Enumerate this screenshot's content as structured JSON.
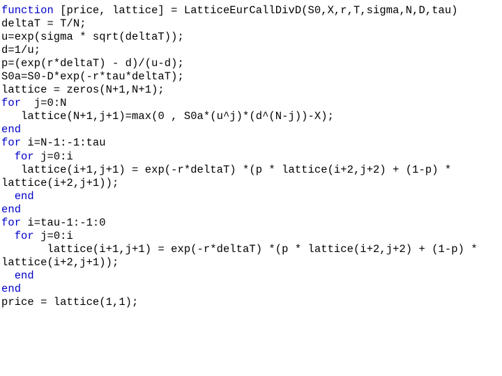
{
  "document": {
    "type": "matlab-code-listing",
    "background_color": "#ffffff",
    "text_color": "#000000",
    "keyword_color": "#0000c8",
    "font_family": "monospace",
    "line_count": 23
  },
  "code": {
    "language": "MATLAB",
    "function_name": "LatticeEurCallDivD",
    "lines": [
      {
        "indent": "",
        "keyword": "function",
        "rest": " [price, lattice] = LatticeEurCallDivD(S0,X,r,T,sigma,N,D,tau)"
      },
      {
        "indent": "",
        "keyword": "",
        "rest": "deltaT = T/N;"
      },
      {
        "indent": "",
        "keyword": "",
        "rest": "u=exp(sigma * sqrt(deltaT));"
      },
      {
        "indent": "",
        "keyword": "",
        "rest": "d=1/u;"
      },
      {
        "indent": "",
        "keyword": "",
        "rest": "p=(exp(r*deltaT) - d)/(u-d);"
      },
      {
        "indent": "",
        "keyword": "",
        "rest": "S0a=S0-D*exp(-r*tau*deltaT);"
      },
      {
        "indent": "",
        "keyword": "",
        "rest": "lattice = zeros(N+1,N+1);"
      },
      {
        "indent": "",
        "keyword": "for",
        "rest": "  j=0:N"
      },
      {
        "indent": "   ",
        "keyword": "",
        "rest": "lattice(N+1,j+1)=max(0 , S0a*(u^j)*(d^(N-j))-X);"
      },
      {
        "indent": "",
        "keyword": "end",
        "rest": ""
      },
      {
        "indent": "",
        "keyword": "for",
        "rest": " i=N-1:-1:tau"
      },
      {
        "indent": "  ",
        "keyword": "for",
        "rest": " j=0:i"
      },
      {
        "indent": "   ",
        "keyword": "",
        "rest": "lattice(i+1,j+1) = exp(-r*deltaT) *(p * lattice(i+2,j+2) + (1-p) *"
      },
      {
        "indent": "",
        "keyword": "",
        "rest": "lattice(i+2,j+1));"
      },
      {
        "indent": "  ",
        "keyword": "end",
        "rest": ""
      },
      {
        "indent": "",
        "keyword": "end",
        "rest": ""
      },
      {
        "indent": "",
        "keyword": "for",
        "rest": " i=tau-1:-1:0"
      },
      {
        "indent": "  ",
        "keyword": "for",
        "rest": " j=0:i"
      },
      {
        "indent": "       ",
        "keyword": "",
        "rest": "lattice(i+1,j+1) = exp(-r*deltaT) *(p * lattice(i+2,j+2) + (1-p) *"
      },
      {
        "indent": "",
        "keyword": "",
        "rest": "lattice(i+2,j+1));"
      },
      {
        "indent": "  ",
        "keyword": "end",
        "rest": ""
      },
      {
        "indent": "",
        "keyword": "end",
        "rest": ""
      },
      {
        "indent": "",
        "keyword": "",
        "rest": "price = lattice(1,1);"
      }
    ]
  }
}
